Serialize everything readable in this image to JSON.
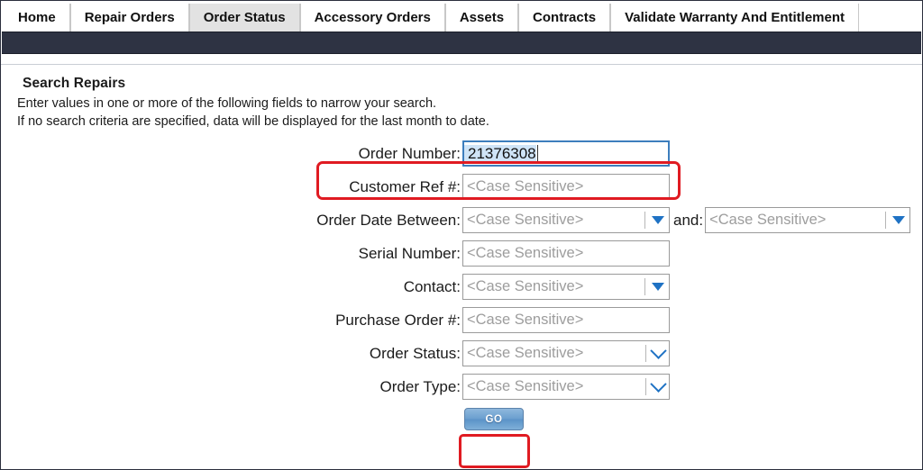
{
  "tabs": [
    {
      "label": "Home",
      "active": false
    },
    {
      "label": "Repair Orders",
      "active": false
    },
    {
      "label": "Order Status",
      "active": true
    },
    {
      "label": "Accessory Orders",
      "active": false
    },
    {
      "label": "Assets",
      "active": false
    },
    {
      "label": "Contracts",
      "active": false
    },
    {
      "label": "Validate Warranty And Entitlement",
      "active": false
    }
  ],
  "page": {
    "title": "Search Repairs",
    "instruction_line1": "Enter values in one or more of the following fields to narrow your search.",
    "instruction_line2": "If no search criteria are specified, data will be displayed for the last month to date."
  },
  "form": {
    "placeholder": "<Case Sensitive>",
    "and_label": "and:",
    "fields": [
      {
        "label": "Order Number:",
        "value": "21376308",
        "placeholder": "",
        "control": "text",
        "focused": true
      },
      {
        "label": "Customer Ref #:",
        "value": "",
        "placeholder": "<Case Sensitive>",
        "control": "text",
        "focused": false
      },
      {
        "label": "Order Date Between:",
        "value": "",
        "placeholder": "<Case Sensitive>",
        "control": "dropdown-triangle",
        "focused": false
      },
      {
        "label": "Serial Number:",
        "value": "",
        "placeholder": "<Case Sensitive>",
        "control": "text",
        "focused": false
      },
      {
        "label": "Contact:",
        "value": "",
        "placeholder": "<Case Sensitive>",
        "control": "dropdown-triangle",
        "focused": false
      },
      {
        "label": "Purchase Order #:",
        "value": "",
        "placeholder": "<Case Sensitive>",
        "control": "text",
        "focused": false
      },
      {
        "label": "Order Status:",
        "value": "",
        "placeholder": "<Case Sensitive>",
        "control": "dropdown-chevron",
        "focused": false
      },
      {
        "label": "Order Type:",
        "value": "",
        "placeholder": "<Case Sensitive>",
        "control": "dropdown-chevron",
        "focused": false
      }
    ],
    "date_end": {
      "placeholder": "<Case Sensitive>",
      "value": ""
    }
  },
  "submit": {
    "label": "GO"
  },
  "colors": {
    "accent_navy": "#2e3343",
    "highlight_red": "#e01b22",
    "focus_blue": "#3d7ebd",
    "dropdown_blue": "#1f72c4",
    "placeholder_gray": "#9d9d9d",
    "active_tab_bg": "#e2e2e2"
  }
}
